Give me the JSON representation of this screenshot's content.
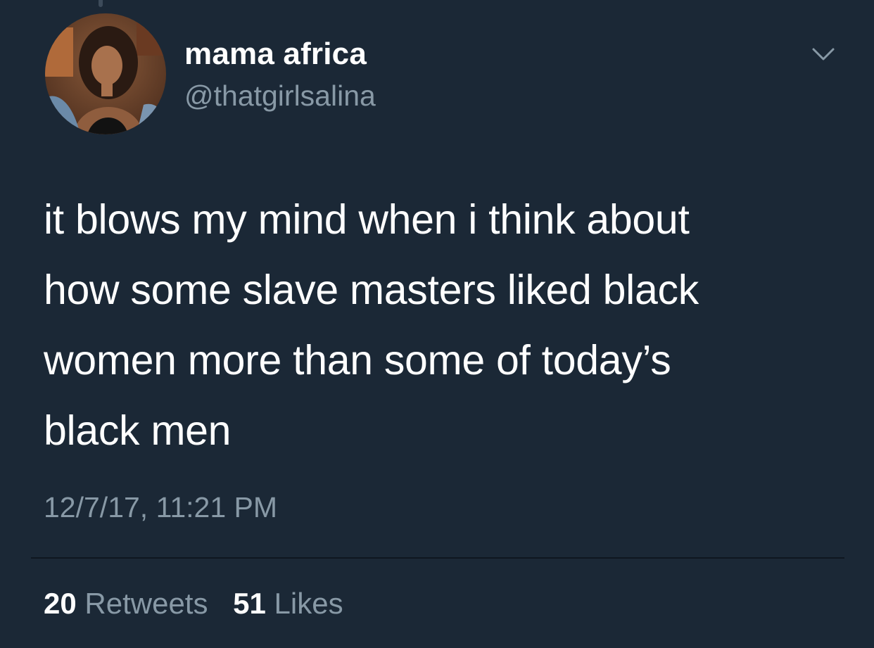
{
  "author": {
    "display_name": "mama africa",
    "handle": "@thatgirlsalina",
    "avatar_icon": "profile-photo"
  },
  "tweet": {
    "text_lines": [
      "it blows my mind when i think about",
      "how some slave masters liked black",
      "women more than some of today’s",
      "black men"
    ],
    "timestamp": "12/7/17, 11:21 PM"
  },
  "stats": {
    "retweets_count": "20",
    "retweets_label": "Retweets",
    "likes_count": "51",
    "likes_label": "Likes"
  },
  "icons": {
    "menu": "chevron-down-icon"
  },
  "colors": {
    "background": "#1b2836",
    "primary_text": "#ffffff",
    "secondary_text": "#8899a6",
    "divider": "#0f1720"
  }
}
